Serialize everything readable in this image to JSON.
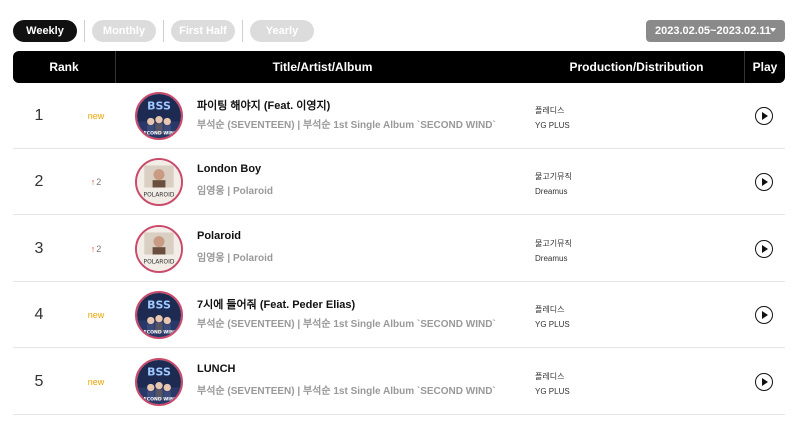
{
  "periods": [
    "Weekly",
    "Monthly",
    "First Half",
    "Yearly"
  ],
  "date_range": "2023.02.05~2023.02.11",
  "headers": {
    "rank": "Rank",
    "title": "Title/Artist/Album",
    "production": "Production/Distribution",
    "play": "Play"
  },
  "rows": [
    {
      "rank": "1",
      "change": "new",
      "change_type": "new",
      "title": "파이팅 해야지 (Feat. 이영지)",
      "meta": "부석순 (SEVENTEEN) | 부석순 1st Single Album `SECOND WIND`",
      "production": "플레디스",
      "distribution": "YG PLUS",
      "cover_art": "bss"
    },
    {
      "rank": "2",
      "change": "2",
      "change_type": "up",
      "title": "London Boy",
      "meta": "임영웅 | Polaroid",
      "production": "물고기뮤직",
      "distribution": "Dreamus",
      "cover_art": "polaroid"
    },
    {
      "rank": "3",
      "change": "2",
      "change_type": "up",
      "title": "Polaroid",
      "meta": "임영웅 | Polaroid",
      "production": "물고기뮤직",
      "distribution": "Dreamus",
      "cover_art": "polaroid"
    },
    {
      "rank": "4",
      "change": "new",
      "change_type": "new",
      "title": "7시에 들어줘 (Feat. Peder Elias)",
      "meta": "부석순 (SEVENTEEN) | 부석순 1st Single Album `SECOND WIND`",
      "production": "플레디스",
      "distribution": "YG PLUS",
      "cover_art": "bss"
    },
    {
      "rank": "5",
      "change": "new",
      "change_type": "new",
      "title": "LUNCH",
      "meta": "부석순 (SEVENTEEN) | 부석순 1st Single Album `SECOND WIND`",
      "production": "플레디스",
      "distribution": "YG PLUS",
      "cover_art": "bss"
    }
  ],
  "cover_text": {
    "bss": {
      "top": "BSS",
      "bottom": "SECOND WIND"
    },
    "polaroid": {
      "bottom": "POLAROID"
    }
  },
  "colors": {
    "active_tab": "#111111",
    "inactive_tab": "#dcdcdc",
    "new_badge": "#e8a400",
    "up_arrow": "#e84a2f",
    "header_bg": "#000000"
  },
  "icons": {
    "up": "up-arrow-icon",
    "play": "play-icon",
    "dropdown": "chevron-down-icon"
  }
}
